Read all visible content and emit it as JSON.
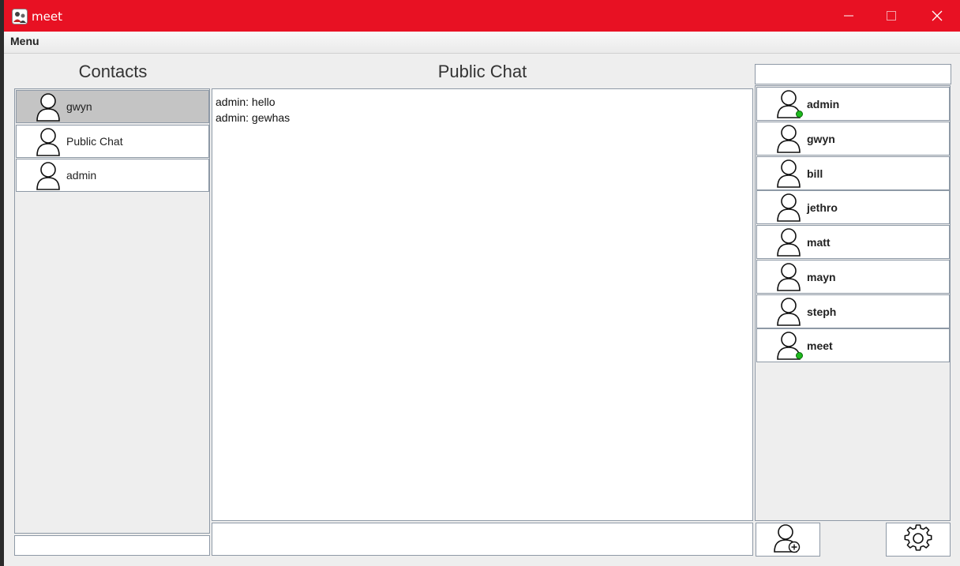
{
  "window": {
    "title": "meet",
    "accent_color": "#e81123",
    "controls": [
      "minimize-icon",
      "maximize-icon",
      "close-icon"
    ]
  },
  "menu": {
    "items": [
      {
        "label": "Menu"
      }
    ]
  },
  "contacts": {
    "title": "Contacts",
    "items": [
      {
        "name": "gwyn",
        "selected": true
      },
      {
        "name": "Public Chat",
        "selected": false
      },
      {
        "name": "admin",
        "selected": false
      }
    ],
    "search_value": ""
  },
  "chat": {
    "title": "Public Chat",
    "messages": [
      {
        "text": "admin: hello"
      },
      {
        "text": "admin: gewhas"
      }
    ],
    "input_value": ""
  },
  "users": {
    "search_value": "",
    "online_color": "#1db91d",
    "items": [
      {
        "name": "admin",
        "online": true
      },
      {
        "name": "gwyn",
        "online": false
      },
      {
        "name": "bill",
        "online": false
      },
      {
        "name": "jethro",
        "online": false
      },
      {
        "name": "matt",
        "online": false
      },
      {
        "name": "mayn",
        "online": false
      },
      {
        "name": "steph",
        "online": false
      },
      {
        "name": "meet",
        "online": true
      }
    ]
  },
  "toolbar": {
    "icons": [
      "add-user-icon",
      "gear-icon"
    ]
  }
}
